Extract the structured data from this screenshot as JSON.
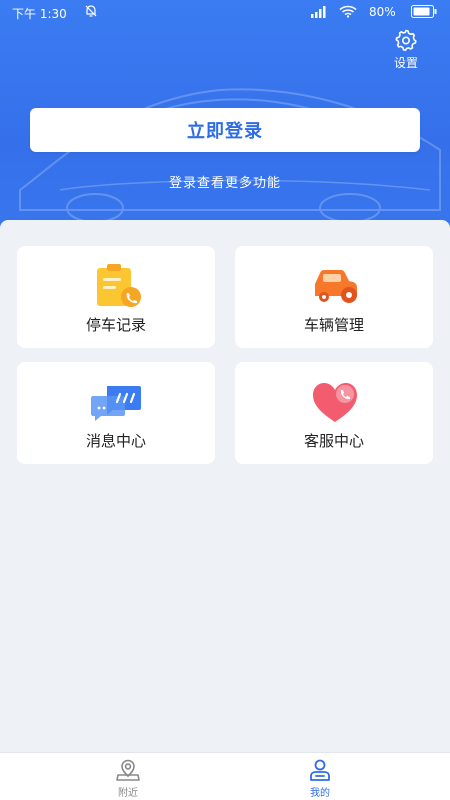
{
  "status_bar": {
    "time": "下午 1:30",
    "battery_pct": "80%"
  },
  "header": {
    "settings_label": "设置",
    "login_button": "立即登录",
    "login_subtitle": "登录查看更多功能"
  },
  "menu": {
    "items": [
      {
        "label": "停车记录",
        "icon": "clipboard-icon"
      },
      {
        "label": "车辆管理",
        "icon": "car-icon"
      },
      {
        "label": "消息中心",
        "icon": "message-icon"
      },
      {
        "label": "客服中心",
        "icon": "heart-phone-icon"
      }
    ]
  },
  "bottom_nav": {
    "items": [
      {
        "label": "附近",
        "icon": "location-icon",
        "active": false
      },
      {
        "label": "我的",
        "icon": "user-icon",
        "active": true
      }
    ]
  },
  "colors": {
    "primary": "#3a78ef",
    "active_tab": "#2f6de6",
    "inactive_tab": "#888888",
    "background": "#eef1f6"
  }
}
